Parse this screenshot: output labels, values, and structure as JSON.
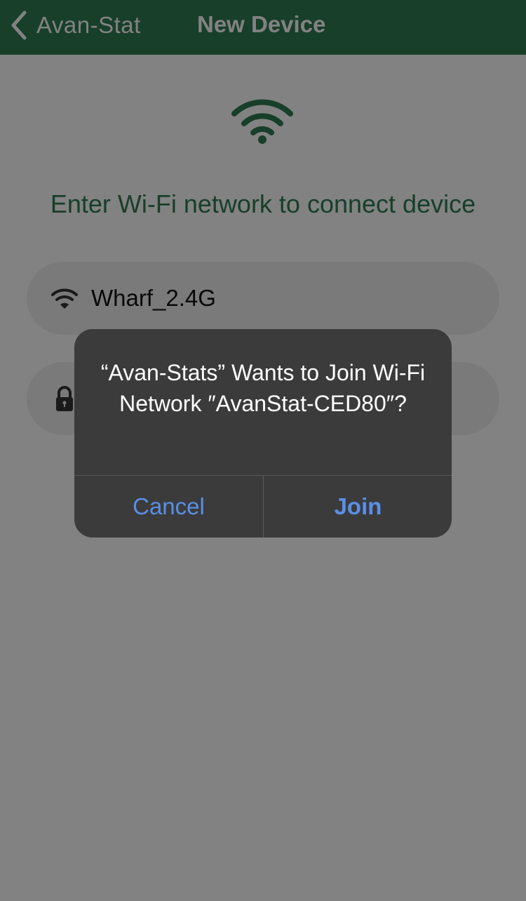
{
  "colors": {
    "brand_green": "#2e7d52",
    "alert_background": "#3b3b3c",
    "alert_button_text": "#5a8fe6",
    "field_background": "#f0f0f0"
  },
  "nav": {
    "back_icon": "chevron-left-icon",
    "back_label": "Avan-Stat",
    "title": "New Device"
  },
  "page": {
    "hero_icon": "wifi-icon",
    "headline": "Enter Wi-Fi network to connect device"
  },
  "form": {
    "ssid": {
      "icon": "wifi-icon",
      "value": "Wharf_2.4G"
    },
    "password": {
      "icon": "lock-icon",
      "value": ""
    }
  },
  "alert": {
    "message": "“Avan-Stats” Wants to Join Wi-Fi Network ″AvanStat-CED80″?",
    "cancel_label": "Cancel",
    "join_label": "Join"
  }
}
